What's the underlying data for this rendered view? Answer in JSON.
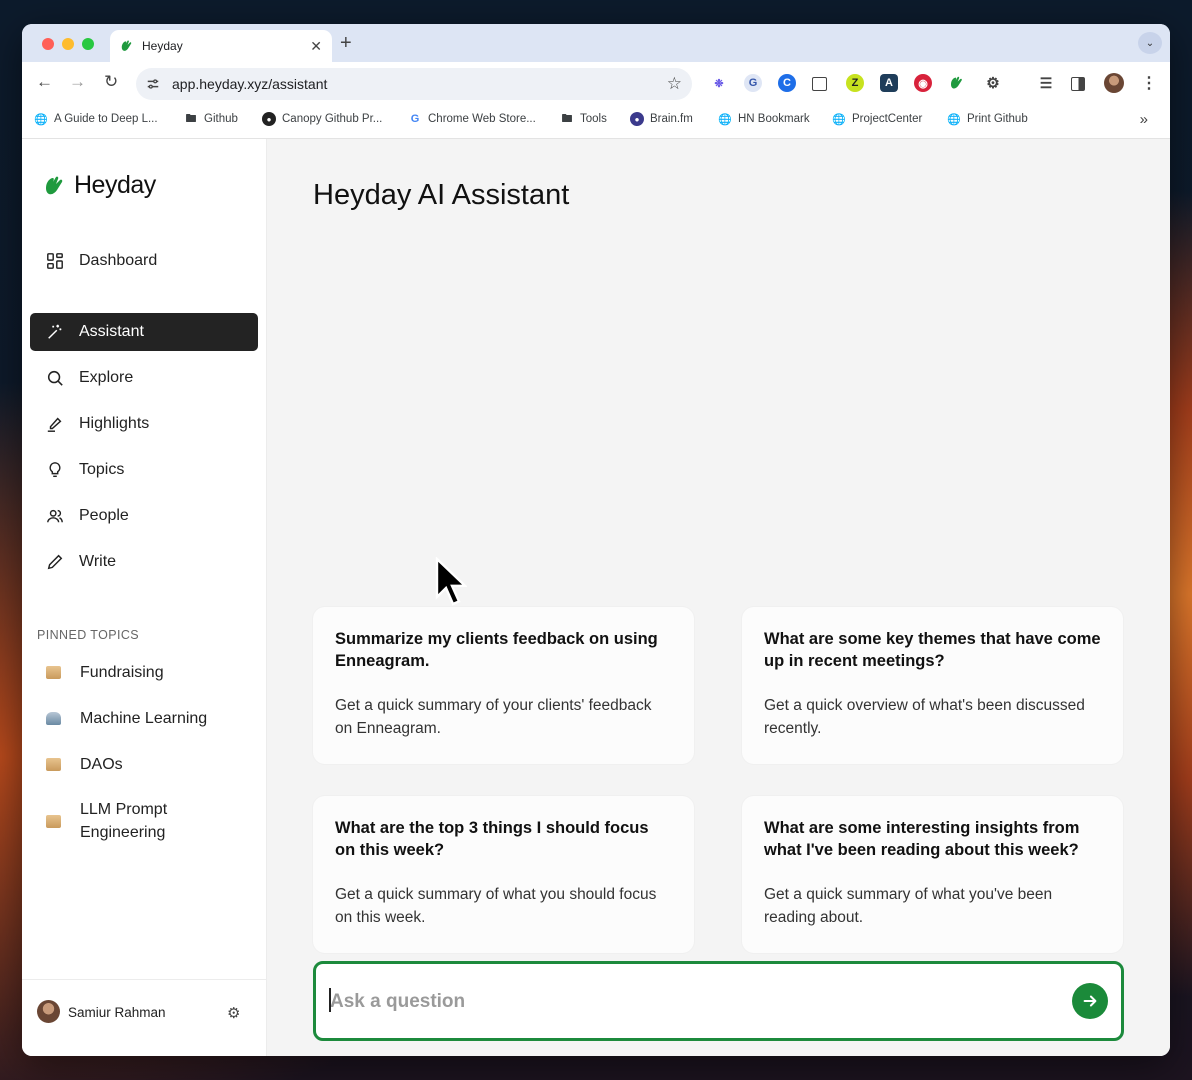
{
  "browser": {
    "tab_title": "Heyday",
    "tab_close": "✕",
    "new_tab": "+",
    "url": "app.heyday.xyz/assistant",
    "bookmarks": [
      {
        "label": "A Guide to Deep L...",
        "icon": "globe-icon"
      },
      {
        "label": "Github",
        "icon": "folder-icon"
      },
      {
        "label": "Canopy Github Pr...",
        "icon": "github-icon"
      },
      {
        "label": "Chrome Web Store...",
        "icon": "google-icon"
      },
      {
        "label": "Tools",
        "icon": "folder-icon"
      },
      {
        "label": "Brain.fm",
        "icon": "brainfm-icon"
      },
      {
        "label": "HN Bookmark",
        "icon": "globe-icon"
      },
      {
        "label": "ProjectCenter",
        "icon": "globe-icon"
      },
      {
        "label": "Print Github",
        "icon": "globe-icon"
      }
    ]
  },
  "app": {
    "logo_text": "Heyday",
    "nav": [
      {
        "label": "Dashboard",
        "icon": "dashboard-icon",
        "active": false
      },
      {
        "label": "Assistant",
        "icon": "magic-wand-icon",
        "active": true
      },
      {
        "label": "Explore",
        "icon": "search-icon",
        "active": false
      },
      {
        "label": "Highlights",
        "icon": "highlighter-icon",
        "active": false
      },
      {
        "label": "Topics",
        "icon": "lightbulb-icon",
        "active": false
      },
      {
        "label": "People",
        "icon": "people-icon",
        "active": false
      },
      {
        "label": "Write",
        "icon": "pencil-icon",
        "active": false
      }
    ],
    "pinned_title": "PINNED TOPICS",
    "pinned_topics": [
      {
        "label": "Fundraising",
        "icon": "box-emoji-icon"
      },
      {
        "label": "Machine Learning",
        "icon": "robot-emoji-icon"
      },
      {
        "label": "DAOs",
        "icon": "box-emoji-icon"
      },
      {
        "label": "LLM Prompt Engineering",
        "icon": "box-emoji-icon"
      }
    ],
    "user": {
      "name": "Samiur Rahman"
    }
  },
  "main": {
    "title": "Heyday AI Assistant",
    "cards": [
      {
        "title": "Summarize my clients feedback on using Enneagram.",
        "desc": "Get a quick summary of your clients' feedback on Enneagram."
      },
      {
        "title": "What are some key themes that have come up in recent meetings?",
        "desc": "Get a quick overview of what's been discussed recently."
      },
      {
        "title": "What are the top 3 things I should focus on this week?",
        "desc": "Get a quick summary of what you should focus on this week."
      },
      {
        "title": "What are some interesting insights from what I've been reading about this week?",
        "desc": "Get a quick summary of what you've been reading about."
      }
    ],
    "ask_placeholder": "Ask a question",
    "ask_value": ""
  },
  "colors": {
    "accent": "#1b8a3a",
    "active_nav": "#232323",
    "brand_green": "#1f9a3e"
  }
}
